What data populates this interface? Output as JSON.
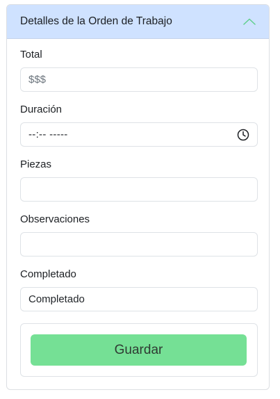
{
  "header": {
    "title": "Detalles de la Orden de Trabajo",
    "chevron_icon": "chevron-up-icon",
    "chevron_color": "#5fcf8c"
  },
  "fields": {
    "total": {
      "label": "Total",
      "placeholder": "$$$",
      "value": ""
    },
    "duracion": {
      "label": "Duración",
      "value": "--:-- -----",
      "icon": "clock-icon"
    },
    "piezas": {
      "label": "Piezas",
      "value": ""
    },
    "observaciones": {
      "label": "Observaciones",
      "value": ""
    },
    "completado": {
      "label": "Completado",
      "value": "Completado"
    }
  },
  "actions": {
    "save_label": "Guardar",
    "save_color": "#75e095"
  }
}
